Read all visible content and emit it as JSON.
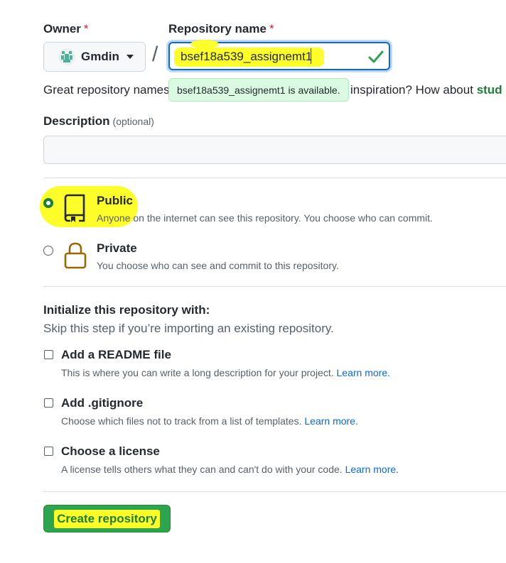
{
  "owner": {
    "label": "Owner",
    "required_mark": "*",
    "value": "Gmdin",
    "avatar_icon": "identicon-avatar",
    "caret_icon": "caret-down-icon"
  },
  "separator": "/",
  "repository": {
    "label": "Repository name",
    "required_mark": "*",
    "value": "bsef18a539_assignemt1",
    "status_icon": "check-icon",
    "availability_message": "bsef18a539_assignemt1 is available."
  },
  "suggestion": {
    "text_start": "Great repository names",
    "text_end": "inspiration? How about",
    "suggested_name_partial": "stud"
  },
  "description": {
    "label": "Description",
    "optional_note": "(optional)",
    "value": ""
  },
  "visibility": {
    "options": [
      {
        "title": "Public",
        "description": "Anyone on the internet can see this repository. You choose who can commit.",
        "selected": true,
        "icon": "repo-icon"
      },
      {
        "title": "Private",
        "description": "You choose who can see and commit to this repository.",
        "selected": false,
        "icon": "lock-icon"
      }
    ]
  },
  "initialize": {
    "title": "Initialize this repository with:",
    "subtitle": "Skip this step if you’re importing an existing repository.",
    "options": [
      {
        "title": "Add a README file",
        "description": "This is where you can write a long description for your project.",
        "link": "Learn more.",
        "checked": false
      },
      {
        "title": "Add .gitignore",
        "description": "Choose which files not to track from a list of templates.",
        "link": "Learn more.",
        "checked": false
      },
      {
        "title": "Choose a license",
        "description": "A license tells others what they can and can't do with your code.",
        "link": "Learn more.",
        "checked": false
      }
    ]
  },
  "submit": {
    "label": "Create repository"
  },
  "colors": {
    "primary_button": "#2da44e",
    "link": "#0969da",
    "success": "#1a7f37",
    "highlight": "#fdfd2a",
    "required": "#cf222e",
    "tooltip_bg": "#dafbe1",
    "repo_icon": "#24292f",
    "lock_icon": "#9a6700"
  }
}
